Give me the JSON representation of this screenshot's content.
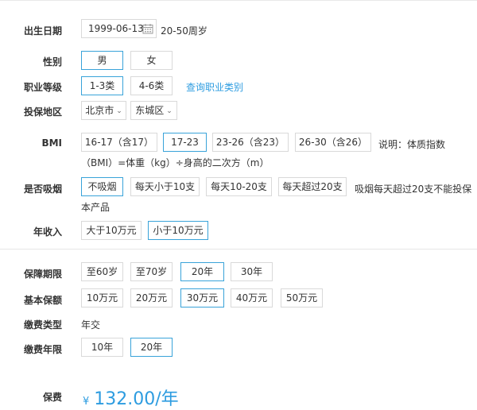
{
  "birth": {
    "label": "出生日期",
    "value": "1999-06-13",
    "hint": "20-50周岁"
  },
  "gender": {
    "label": "性别",
    "options": [
      "男",
      "女"
    ],
    "selected": "男"
  },
  "job": {
    "label": "职业等级",
    "options": [
      "1-3类",
      "4-6类"
    ],
    "selected": "1-3类",
    "link": "查询职业类别"
  },
  "region": {
    "label": "投保地区",
    "city": "北京市",
    "district": "东城区"
  },
  "bmi": {
    "label": "BMI",
    "options": [
      "16-17（含17）",
      "17-23",
      "23-26（含23）",
      "26-30（含26）"
    ],
    "selected": "17-23",
    "note_line1": "说明：体质指数",
    "note_line2": "（BMI）=体重（kg）÷身高的二次方（m）"
  },
  "smoke": {
    "label": "是否吸烟",
    "options": [
      "不吸烟",
      "每天小于10支",
      "每天10-20支",
      "每天超过20支"
    ],
    "selected": "不吸烟",
    "note_line1": "吸烟每天超过20支不能投保",
    "note_line2": "本产品"
  },
  "income": {
    "label": "年收入",
    "options": [
      "大于10万元",
      "小于10万元"
    ],
    "selected": "小于10万元"
  },
  "term": {
    "label": "保障期限",
    "options": [
      "至60岁",
      "至70岁",
      "20年",
      "30年"
    ],
    "selected": "20年"
  },
  "coverage": {
    "label": "基本保额",
    "options": [
      "10万元",
      "20万元",
      "30万元",
      "40万元",
      "50万元"
    ],
    "selected": "30万元"
  },
  "payment_type": {
    "label": "缴费类型",
    "value": "年交"
  },
  "payment_years": {
    "label": "缴费年限",
    "options": [
      "10年",
      "20年"
    ],
    "selected": "20年"
  },
  "premium": {
    "label": "保费",
    "currency": "¥",
    "amount": "132.00/年"
  },
  "colors": {
    "accent": "#2d9ce0",
    "selected_border": "#39a3d9",
    "border": "#d9d9d9"
  },
  "icons": [
    "calendar-icon",
    "chevron-down-icon"
  ]
}
